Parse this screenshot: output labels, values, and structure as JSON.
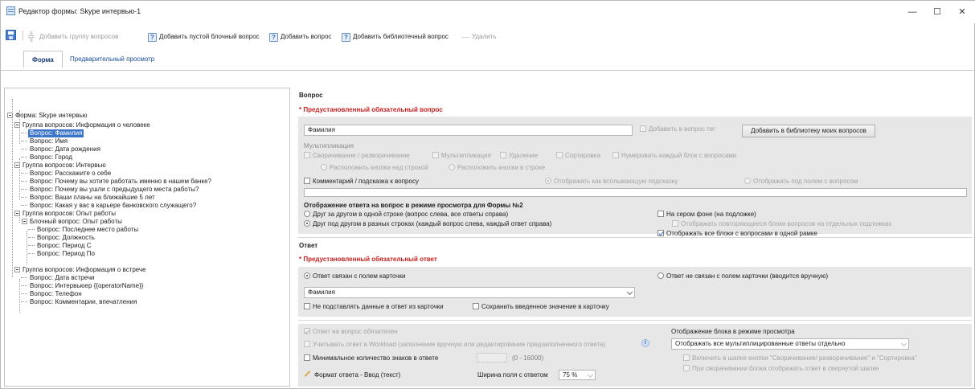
{
  "window": {
    "title": "Редактор формы: Skype интервью-1",
    "minimize": "—",
    "maximize": "☐",
    "close": "✕"
  },
  "toolbar": {
    "add_group": "Добавить группу вопросов",
    "add_block": "Добавить пустой блочный вопрос",
    "add_question": "Добавить вопрос",
    "add_library": "Добавить библиотечный вопрос",
    "delete": "Удалить"
  },
  "tabs": {
    "form": "Форма",
    "preview": "Предварительный просмотр"
  },
  "tree": {
    "root": "Форма: Skype интервью",
    "g1": "Группа вопросов: Информация о человеке",
    "g1_items": [
      "Вопрос: Фамилия",
      "Вопрос: Имя",
      "Вопрос: Дата рождения",
      "Вопрос: Город"
    ],
    "g2": "Группа вопросов: Интервью",
    "g2_items": [
      "Вопрос: Расскажите о себе",
      "Вопрос: Почему вы хотите работать именно в нашем банке?",
      "Вопрос: Почему вы ушли с предыдущего места работы?",
      "Вопрос: Ваши планы на ближайшие 5 лет",
      "Вопрос: Какая у вас в карьере банковского служащего?"
    ],
    "g3": "Группа вопросов: Опыт работы",
    "g3_block": "Блочный вопрос: Опыт работы",
    "g3_items": [
      "Вопрос: Последнее место работы",
      "Вопрос: Должность",
      "Вопрос: Период С",
      "Вопрос: Период По"
    ],
    "g4": "Группа вопросов: Информация о встрече",
    "g4_items": [
      "Вопрос: Дата встречи",
      "Вопрос: Интервьюер {{operatorName}}",
      "Вопрос: Телефон",
      "Вопрос: Комментарии, впечатления"
    ]
  },
  "question": {
    "header": "Вопрос",
    "required_label": "* Предустановленный обязательный вопрос",
    "text_value": "Фамилия",
    "add_tag": "Добавить в вопрос тег",
    "add_to_library": "Добавить в библиотеку моих вопросов",
    "multiplication": "Мультипликация",
    "opt_collapse": "Сворачивание / разворачивание",
    "opt_multiplication": "Мультипликация",
    "opt_delete": "Удаление",
    "opt_sort": "Сортировка",
    "opt_number": "Нумеровать каждый блок с вопросами",
    "opt_buttons_below": "Расположить кнопки над строкой",
    "opt_buttons_inline": "Расположить кнопки в строке",
    "comment_hint": "Комментарий / подсказка к вопросу",
    "show_as_tooltip": "Отображать как всплывающую подсказку",
    "show_under_field": "Отображать под полем с вопросом",
    "display_header": "Отображение ответа на вопрос в режиме просмотра для Формы №2",
    "display_opt1": "Друг за другом в одной строке (вопрос слева, все ответы справа)",
    "display_opt2": "Друг под другом в разных строках (каждый вопрос слева, каждый ответ справа)",
    "grey_bg": "На сером фоне (на подложке)",
    "repeat_blocks": "Отображать повторяющиеся блоки вопросов на отдельных подложках",
    "one_frame": "Отображать все блоки с вопросами в одной рамке"
  },
  "answer": {
    "header": "Ответ",
    "required_label": "* Предустановленный обязательный ответ",
    "linked": "Ответ связан с полем карточки",
    "not_linked": "Ответ не связан с полем карточки (вводится вручную)",
    "field_value": "Фамилия",
    "no_substitute": "Не подставлять данные в ответ из карточки",
    "save_to_card": "Сохранить введенное значение в карточку",
    "mandatory": "Ответ на вопрос обязателен",
    "workload": "Учитывать ответ в Workload (заполнение вручную или редактирование предзаполненного ответа)",
    "info_icon": "i",
    "min_chars": "Минимальное количество знаков в ответе",
    "min_range": "(0 - 16000)",
    "format": "Формат ответа - Ввод (текст)",
    "width_label": "Ширина поля с ответом",
    "width_value": "75 %",
    "block_display_header": "Отображение блока в режиме просмотра",
    "block_display_value": "Отображать все мультиплицированные ответы отдельно",
    "include_buttons": "Включить в шапке кнопки \"Сворачивание/ разворачивание\" и \"Сортировка\"",
    "collapsed_answer": "При сворачивании блока отображать ответ в свернутой шапке"
  },
  "colors": {
    "accent": "#3b74c9",
    "required": "#c81e1e",
    "panel_bg": "#e7e7e7"
  }
}
